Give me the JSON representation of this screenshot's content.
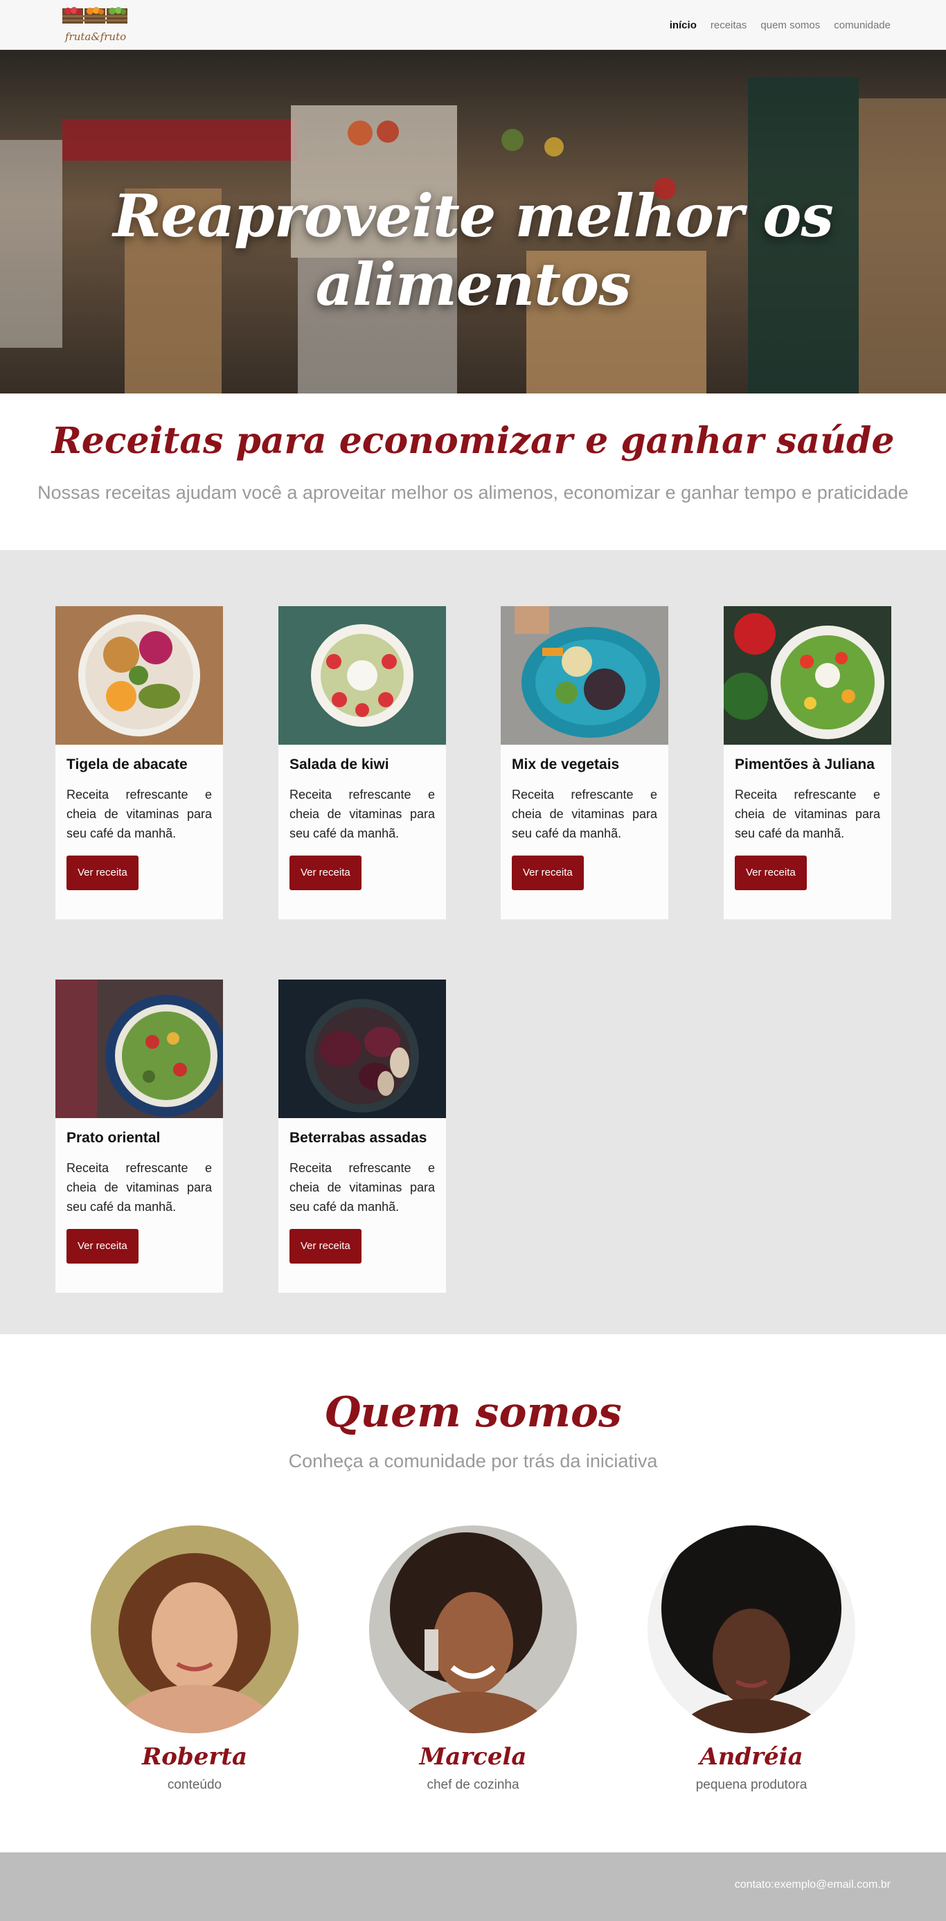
{
  "brand": {
    "logo_text": "fruta&fruto",
    "accent": "#8b1219",
    "button_color": "#8b0f14"
  },
  "nav": {
    "items": [
      {
        "label": "início",
        "active": true
      },
      {
        "label": "receitas",
        "active": false
      },
      {
        "label": "quem somos",
        "active": false
      },
      {
        "label": "comunidade",
        "active": false
      }
    ]
  },
  "hero": {
    "title": "Reaproveite melhor os alimentos"
  },
  "intro": {
    "title": "Receitas para economizar e ganhar saúde",
    "subtitle": "Nossas receitas ajudam você a aproveitar melhor os alimenos, economizar e ganhar tempo e praticidade"
  },
  "recipes": {
    "cards": [
      {
        "title": "Tigela de abacate",
        "text": "Receita refrescante e cheia de vitaminas para seu café da manhã.",
        "button": "Ver receita"
      },
      {
        "title": "Salada de kiwi",
        "text": "Receita refrescante e cheia de vitaminas para seu café da manhã.",
        "button": "Ver receita"
      },
      {
        "title": "Mix de vegetais",
        "text": "Receita refrescante e cheia de vitaminas para seu café da manhã.",
        "button": "Ver receita"
      },
      {
        "title": "Pimentões à Juliana",
        "text": "Receita refrescante e cheia de vitaminas para seu café da manhã.",
        "button": "Ver receita"
      },
      {
        "title": "Prato oriental",
        "text": "Receita refrescante e cheia de vitaminas para seu café da manhã.",
        "button": "Ver receita"
      },
      {
        "title": "Beterrabas assadas",
        "text": "Receita refrescante e cheia de vitaminas para seu café da manhã.",
        "button": "Ver receita"
      }
    ]
  },
  "about": {
    "title": "Quem somos",
    "subtitle": "Conheça a comunidade por trás da iniciativa",
    "members": [
      {
        "name": "Roberta",
        "role": "conteúdo"
      },
      {
        "name": "Marcela",
        "role": "chef de cozinha"
      },
      {
        "name": "Andréia",
        "role": "pequena produtora"
      }
    ]
  },
  "footer": {
    "contact": "contato:exemplo@email.com.br"
  }
}
